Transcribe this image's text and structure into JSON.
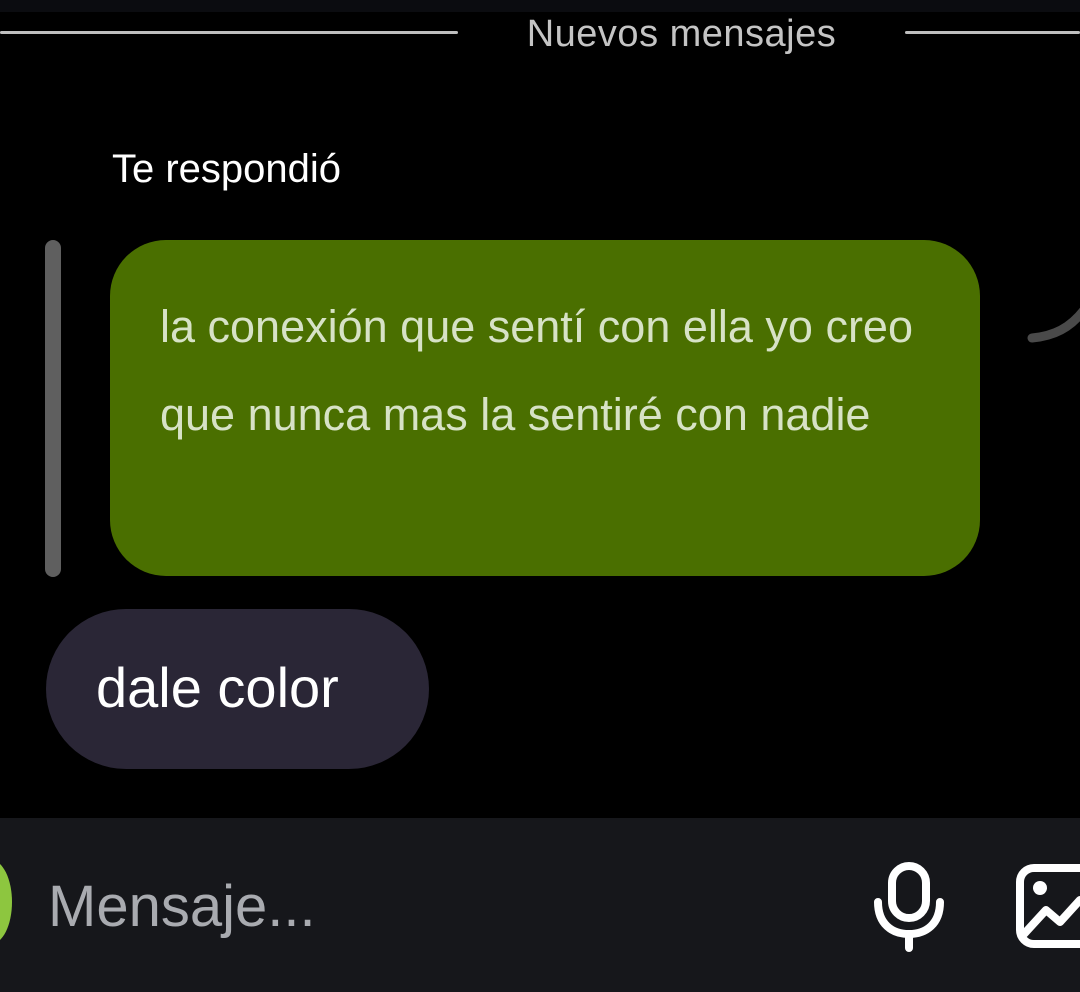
{
  "divider": {
    "label": "Nuevos mensajes"
  },
  "reply": {
    "label": "Te respondió",
    "quoted_message": "la conexión que sentí con ella yo creo que nunca mas la sentiré con nadie"
  },
  "messages": [
    {
      "text": "dale color",
      "sender": "self"
    }
  ],
  "composer": {
    "placeholder": "Mensaje...",
    "icons": {
      "avatar": "avatar-icon",
      "mic": "microphone-icon",
      "gallery": "image-icon"
    }
  },
  "colors": {
    "background": "#000000",
    "quoted_bubble": "#4a6f00",
    "message_bubble": "#2a2636",
    "composer_bar": "#16171b"
  }
}
